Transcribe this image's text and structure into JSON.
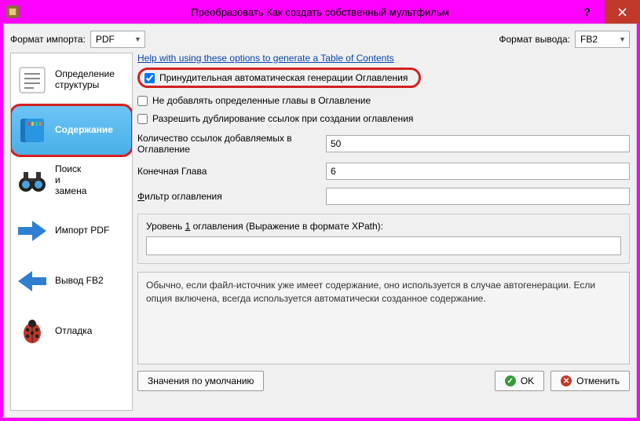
{
  "window": {
    "title": "Преобразовать Как создать собственный мультфильм"
  },
  "toprow": {
    "import_label": "Формат импорта:",
    "import_value": "PDF",
    "output_label": "Формат вывода:",
    "output_value": "FB2"
  },
  "sidebar": {
    "items": [
      {
        "label": "Определение структуры"
      },
      {
        "label": "Содержание"
      },
      {
        "label": "Поиск\nи\nзамена"
      },
      {
        "label": "Импорт PDF"
      },
      {
        "label": "Вывод FB2"
      },
      {
        "label": "Отладка"
      }
    ]
  },
  "content": {
    "help_link": "Help with using these options to generate a Table of Contents",
    "chk_force": "Принудительная автоматическая генерации Оглавления",
    "chk_noadd": "Не добавлять определенные главы в Оглавление",
    "chk_dup": "Разрешить дублирование ссылок при создании оглавления",
    "links_count_label": "Количество ссылок добавляемых в Оглавление",
    "links_count": "50",
    "end_chapter_label": "Конечная Глава",
    "end_chapter": "6",
    "filter_prefix": "Ф",
    "filter_rest": "ильтр оглавления",
    "level_prefix": "Уровень ",
    "level_num": "1",
    "level_rest": " оглавления (Выражение в формате XPath):",
    "info_text": "Обычно, если файл-источник уже имеет содержание, оно используется в случае автогенерации. Если опция включена, всегда используется автоматически созданное содержание."
  },
  "buttons": {
    "defaults": "Значения по умолчанию",
    "ok": "OK",
    "cancel": "Отменить"
  }
}
